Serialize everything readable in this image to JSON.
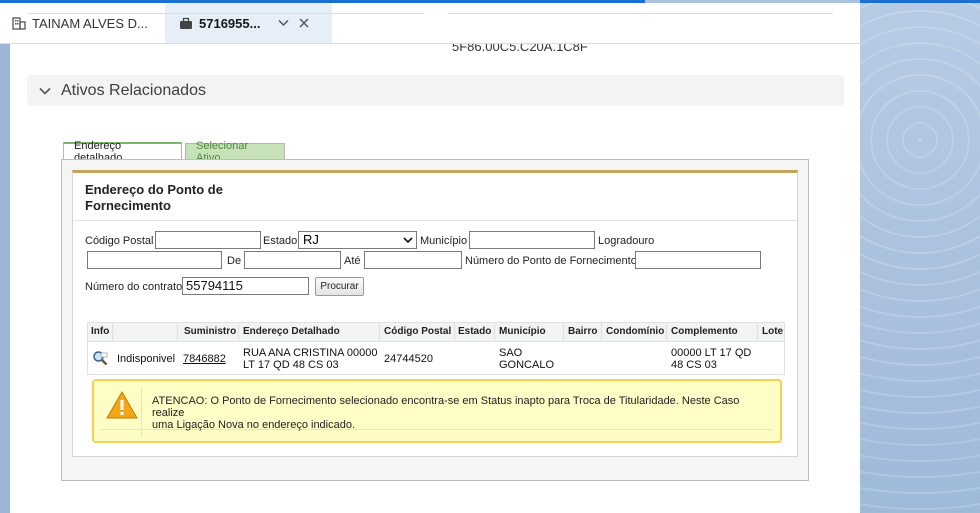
{
  "tabs": [
    {
      "label": "TAINAM ALVES D...",
      "icon": "building-icon"
    },
    {
      "label": "5716955...",
      "icon": "briefcase-icon"
    }
  ],
  "top_field_value": "5F86.00C5.C20A.1C8F",
  "section": {
    "title": "Ativos Relacionados",
    "icon": "chevron-down-icon"
  },
  "subtabs": [
    {
      "label": "Endereço detalhado",
      "active": true
    },
    {
      "label": "Selecionar Ativo",
      "active": false
    }
  ],
  "panel": {
    "title": "Endereço do Ponto de Fornecimento"
  },
  "form": {
    "codigo_postal_label": "Código Postal",
    "codigo_postal_value": "",
    "estado_label": "Estado",
    "estado_value": "RJ",
    "municipio_label": "Município",
    "municipio_value": "",
    "logradouro_label": "Logradouro",
    "logradouro_value": "",
    "de_label": "De",
    "de_value": "",
    "ate_label": "Até",
    "ate_value": "",
    "numero_ponto_label": "Número do Ponto de Fornecimento",
    "numero_ponto_value": "",
    "numero_contrato_label": "Número do contrato",
    "numero_contrato_value": "55794115",
    "procurar_label": "Procurar"
  },
  "table": {
    "headers": [
      "Info",
      "",
      "Suministro",
      "Endereço Detalhado",
      "Código Postal",
      "Estado",
      "Município",
      "Bairro",
      "Condomínio",
      "Complemento",
      "Lote"
    ],
    "row": {
      "status": "Indisponivel",
      "suministro": "7846882",
      "endereco_line1": "RUA ANA CRISTINA 00000",
      "endereco_line2": "LT 17 QD 48 CS 03",
      "codigo_postal": "24744520",
      "estado": "",
      "municipio_line1": "SAO",
      "municipio_line2": "GONCALO",
      "bairro": "",
      "condominio": "",
      "complemento_line1": "00000 LT 17 QD",
      "complemento_line2": "48 CS 03",
      "lote": ""
    }
  },
  "warning": {
    "line1": "ATENCAO: O Ponto de Fornecimento selecionado encontra-se em Status inapto para Troca de Titularidade. Neste Caso realize",
    "line2": "uma Ligação Nova no endereço indicado.",
    "icon": "warning-icon"
  },
  "colors": {
    "accent_blue": "#1b6fd0",
    "active_tab_bg": "#e6eef8",
    "panel_top_border": "#c2a55a",
    "inactive_subtab_bg": "#c7e2b9",
    "warning_bg": "#fffdc6",
    "warning_border": "#f4d24e"
  }
}
